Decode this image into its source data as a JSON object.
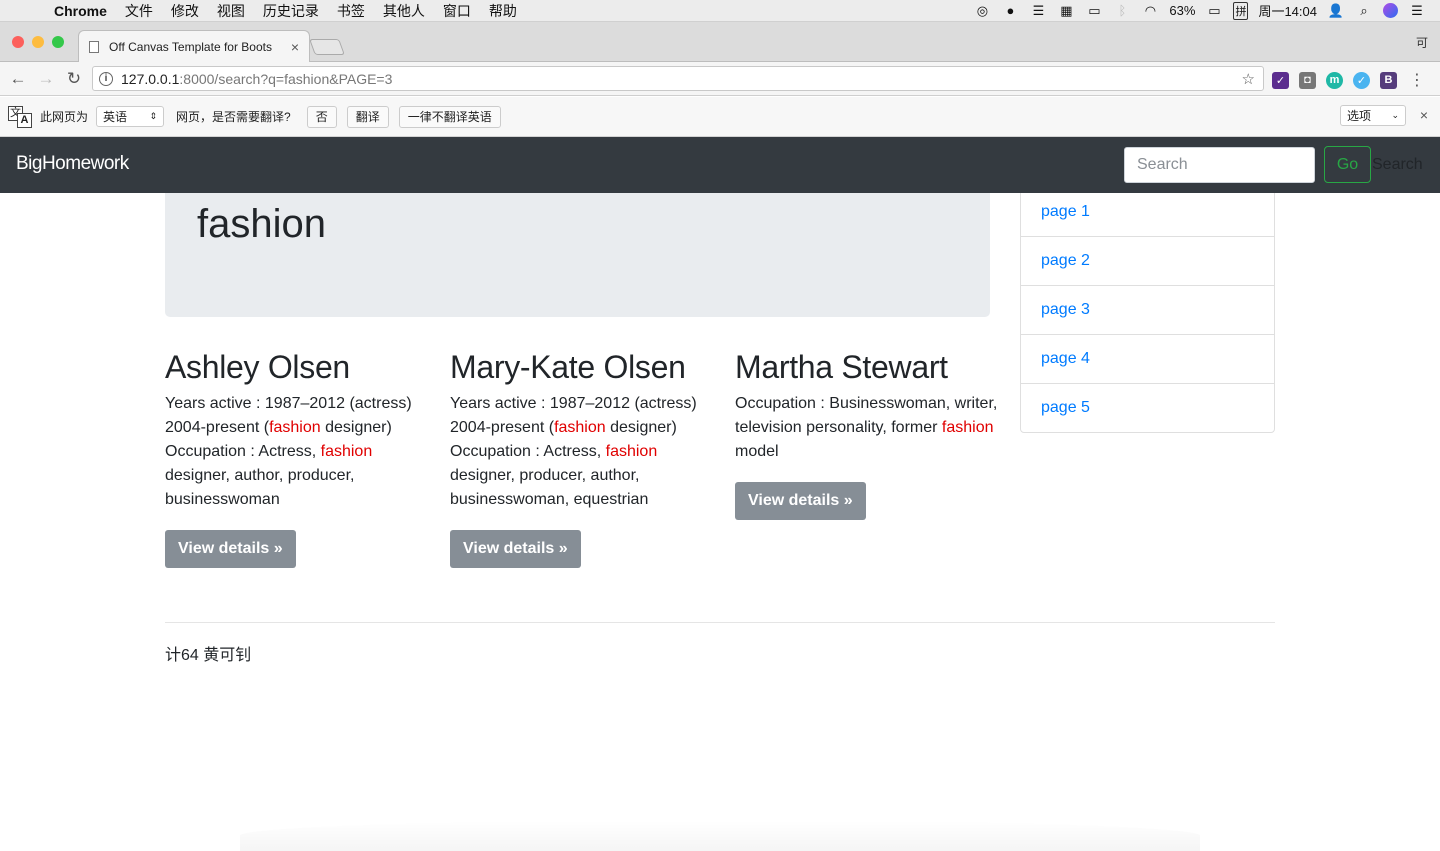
{
  "os_menubar": {
    "app_name": "Chrome",
    "menus": [
      "文件",
      "修改",
      "视图",
      "历史记录",
      "书签",
      "其他人",
      "窗口",
      "帮助"
    ],
    "battery": "63%",
    "input_method": "拼",
    "clock": "周一14:04"
  },
  "browser": {
    "tab_title": "Off Canvas Template for Boots",
    "profile_label": "可",
    "url_host": "127.0.0.1",
    "url_rest": ":8000/search?q=fashion&PAGE=3"
  },
  "translate_bar": {
    "prefix": "此网页为",
    "language": "英语",
    "question": "网页，是否需要翻译?",
    "no_label": "否",
    "translate_label": "翻译",
    "never_label": "一律不翻译英语",
    "options_label": "选项"
  },
  "navbar": {
    "brand": "BigHomework",
    "search_placeholder": "Search",
    "go_label": "Go",
    "search_ghost": "Search"
  },
  "jumbotron": {
    "heading": "fashion"
  },
  "results": [
    {
      "name": "Ashley Olsen",
      "button": "View details »"
    },
    {
      "name": "Mary-Kate Olsen",
      "button": "View details »"
    },
    {
      "name": "Martha Stewart",
      "button": "View details »"
    }
  ],
  "highlight_term": "fashion",
  "sidebar": {
    "pages": [
      "page 1",
      "page 2",
      "page 3",
      "page 4",
      "page 5"
    ]
  },
  "footer": {
    "text": "计64 黄可钊"
  },
  "colors": {
    "navbar_bg": "#343a40",
    "highlight": "#e00000",
    "link": "#007bff",
    "go_button": "#28a745",
    "view_button": "#868e96"
  }
}
